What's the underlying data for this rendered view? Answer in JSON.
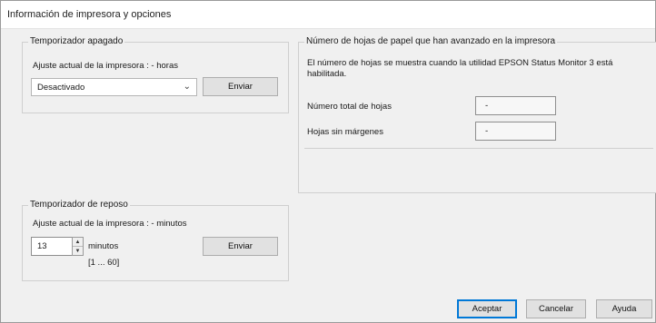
{
  "window": {
    "title": "Información de impresora y opciones"
  },
  "power_off_timer": {
    "title": "Temporizador apagado",
    "current_setting": "Ajuste actual de la impresora : - horas",
    "select_value": "Desactivado",
    "send_label": "Enviar"
  },
  "sheets": {
    "title": "Número de hojas de papel que han avanzado en la impresora",
    "note_line1": "El número de hojas se muestra cuando la utilidad EPSON Status Monitor 3 está",
    "note_line2": "habilitada.",
    "total_label": "Número total de hojas",
    "total_value": "-",
    "borderless_label": "Hojas sin márgenes",
    "borderless_value": "-"
  },
  "sleep_timer": {
    "title": "Temporizador de reposo",
    "current_setting": "Ajuste actual de la impresora : - minutos",
    "value": "13",
    "unit": "minutos",
    "range": "[1 ... 60]",
    "send_label": "Enviar"
  },
  "footer": {
    "ok": "Aceptar",
    "cancel": "Cancelar",
    "help": "Ayuda"
  },
  "icons": {
    "chevron": "chevron-down-icon",
    "spin_up": "spin-up-icon",
    "spin_down": "spin-down-icon"
  }
}
